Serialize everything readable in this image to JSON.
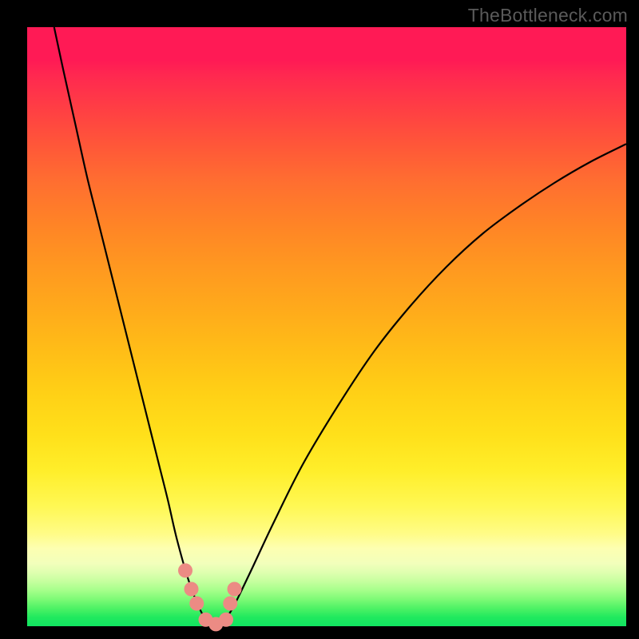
{
  "watermark": "TheBottleneck.com",
  "colors": {
    "frame": "#000000",
    "curve": "#000000",
    "marker_fill": "#ec8b84",
    "marker_stroke": "#c86b67"
  },
  "chart_data": {
    "type": "line",
    "title": "",
    "xlabel": "",
    "ylabel": "",
    "xlim": [
      0,
      100
    ],
    "ylim": [
      0,
      100
    ],
    "grid": false,
    "legend": false,
    "series": [
      {
        "name": "bottleneck-curve",
        "x": [
          4.5,
          6,
          8,
          10,
          12,
          14,
          16,
          18,
          20,
          22,
          23.5,
          25,
          27,
          29,
          30.5,
          32,
          34,
          37,
          41,
          46,
          52,
          58,
          64,
          70,
          76,
          82,
          88,
          94,
          100
        ],
        "values": [
          100,
          93,
          84,
          75,
          67,
          59,
          51,
          43,
          35,
          27,
          21,
          14.5,
          7.5,
          2.5,
          0.3,
          0.3,
          2.5,
          8.5,
          17,
          27,
          37,
          46,
          53.5,
          60,
          65.5,
          70,
          74,
          77.5,
          80.5
        ]
      }
    ],
    "markers": {
      "name": "curve-dots",
      "x": [
        26.4,
        27.4,
        28.3,
        29.8,
        31.5,
        33.2,
        33.9,
        34.6
      ],
      "values": [
        9.3,
        6.2,
        3.8,
        1.1,
        0.35,
        1.1,
        3.8,
        6.2
      ],
      "radius_px": 9
    },
    "background_gradient": {
      "stops": [
        {
          "pos": 0.0,
          "color": "#ff1a55"
        },
        {
          "pos": 0.33,
          "color": "#ff8426"
        },
        {
          "pos": 0.68,
          "color": "#ffee2a"
        },
        {
          "pos": 0.87,
          "color": "#fdffb1"
        },
        {
          "pos": 1.0,
          "color": "#11e461"
        }
      ]
    }
  }
}
